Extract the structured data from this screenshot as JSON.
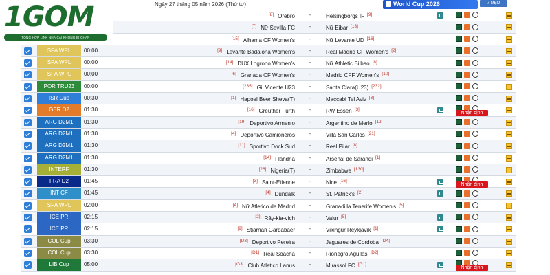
{
  "header": {
    "date_text": "Ngày 27 tháng 05 năm 2026 (Thứ tư)",
    "wc_banner": "World Cup 2026",
    "more_button": "7 MẸO"
  },
  "logo": {
    "brand": "1GOM",
    "tagline": "TỔNG HỢP LINK NHÀ CÁI KHÔNG BỊ CHẶN"
  },
  "colors": {
    "SPA WPL": "#e0c65a",
    "POR TRU23": "#2e8b3a",
    "ISR Cup": "#2f7ed8",
    "GER D2": "#e37c2a",
    "ARG D2M1": "#1f6fbf",
    "INTERF": "#a7b036",
    "FRA D2": "#0a2a8a",
    "INT CF": "#2f90c9",
    "ICE PR": "#2c68c3",
    "COL Cup": "#8c8b45",
    "LIB Cup": "#1f7a3a"
  },
  "matches": [
    {
      "league": "",
      "time": "",
      "home_rank": "[8]",
      "home": "Orebro",
      "away": "Helsingborgs IF",
      "away_rank": "[9]",
      "tv": true,
      "nhan": false
    },
    {
      "league": "",
      "time": "",
      "home_rank": "[7]",
      "home": "Nữ Sevilla FC",
      "away": "Nữ Eibar",
      "away_rank": "[13]",
      "tv": false,
      "nhan": false
    },
    {
      "league": "",
      "time": "",
      "home_rank": "[15]",
      "home": "Alhama CF Women's",
      "away": "Nữ Levante UD",
      "away_rank": "[16]",
      "tv": false,
      "nhan": false
    },
    {
      "league": "SPA WPL",
      "time": "00:00",
      "home_rank": "[9]",
      "home": "Levante Badalona Women's",
      "away": "Real Madrid CF Women's",
      "away_rank": "[2]",
      "tv": false,
      "nhan": false
    },
    {
      "league": "SPA WPL",
      "time": "00:00",
      "home_rank": "[14]",
      "home": "DUX Logrono Women's",
      "away": "Nữ Athletic Bilbao",
      "away_rank": "[8]",
      "tv": false,
      "nhan": false
    },
    {
      "league": "SPA WPL",
      "time": "00:00",
      "home_rank": "[6]",
      "home": "Granada CF Women's",
      "away": "Madrid CFF Women's",
      "away_rank": "[10]",
      "tv": false,
      "nhan": false
    },
    {
      "league": "POR TRU23",
      "time": "00:00",
      "home_rank": "[235]",
      "home": "Gil Vicente U23",
      "away": "Santa Clara(U23)",
      "away_rank": "[232]",
      "tv": false,
      "nhan": false
    },
    {
      "league": "ISR Cup",
      "time": "00:30",
      "home_rank": "[1]",
      "home": "Hapoel Beer Sheva(T)",
      "away": "Maccabi Tel Aviv",
      "away_rank": "[3]",
      "tv": false,
      "nhan": false
    },
    {
      "league": "GER D2",
      "time": "01:30",
      "home_rank": "[16]",
      "home": "Greuther Furth",
      "away": "RW Essen",
      "away_rank": "[3]",
      "tv": true,
      "nhan": true
    },
    {
      "league": "ARG D2M1",
      "time": "01:30",
      "home_rank": "[19]",
      "home": "Deportivo Armenio",
      "away": "Argentino de Merlo",
      "away_rank": "[12]",
      "tv": false,
      "nhan": false
    },
    {
      "league": "ARG D2M1",
      "time": "01:30",
      "home_rank": "[4]",
      "home": "Deportivo Camioneros",
      "away": "Villa San Carlos",
      "away_rank": "[21]",
      "tv": false,
      "nhan": false
    },
    {
      "league": "ARG D2M1",
      "time": "01:30",
      "home_rank": "[11]",
      "home": "Sportivo Dock Sud",
      "away": "Real Pilar",
      "away_rank": "[8]",
      "tv": false,
      "nhan": false
    },
    {
      "league": "ARG D2M1",
      "time": "01:30",
      "home_rank": "[14]",
      "home": "Flandria",
      "away": "Arsenal de Sarandi",
      "away_rank": "[1]",
      "tv": false,
      "nhan": false
    },
    {
      "league": "INTERF",
      "time": "01:30",
      "home_rank": "[26]",
      "home": "Nigeria(T)",
      "away": "Zimbabwe",
      "away_rank": "[130]",
      "tv": false,
      "nhan": false
    },
    {
      "league": "FRA D2",
      "time": "01:45",
      "home_rank": "[3]",
      "home": "Saint-Etienne",
      "away": "Nice",
      "away_rank": "[16]",
      "tv": true,
      "nhan": true
    },
    {
      "league": "INT CF",
      "time": "01:45",
      "home_rank": "[4]",
      "home": "Dundalk",
      "away": "St. Patrick's",
      "away_rank": "[2]",
      "tv": true,
      "nhan": false
    },
    {
      "league": "SPA WPL",
      "time": "02:00",
      "home_rank": "[4]",
      "home": "Nữ Atletico de Madrid",
      "away": "Granadilla Tenerife Women's",
      "away_rank": "[5]",
      "tv": false,
      "nhan": false
    },
    {
      "league": "ICE PR",
      "time": "02:15",
      "home_rank": "[2]",
      "home": "Rây-kia-vích",
      "away": "Valur",
      "away_rank": "[5]",
      "tv": true,
      "nhan": false
    },
    {
      "league": "ICE PR",
      "time": "02:15",
      "home_rank": "[9]",
      "home": "Stjarnan Gardabaer",
      "away": "Vikingur Reykjavik",
      "away_rank": "[1]",
      "tv": true,
      "nhan": false
    },
    {
      "league": "COL Cup",
      "time": "03:30",
      "home_rank": "[D3]",
      "home": "Deportivo Pereira",
      "away": "Jaguares de Cordoba",
      "away_rank": "[D4]",
      "tv": false,
      "nhan": false
    },
    {
      "league": "COL Cup",
      "time": "03:30",
      "home_rank": "[D1]",
      "home": "Real Soacha",
      "away": "Rionegro Aguilas",
      "away_rank": "[D2]",
      "tv": false,
      "nhan": false
    },
    {
      "league": "LIB Cup",
      "time": "05:00",
      "home_rank": "[G3]",
      "home": "Club Atletico Lanus",
      "away": "Mirassol FC",
      "away_rank": "[G1]",
      "tv": true,
      "nhan": true
    }
  ],
  "labels": {
    "nhan_dinh": "Nhận định",
    "dash": "-"
  }
}
